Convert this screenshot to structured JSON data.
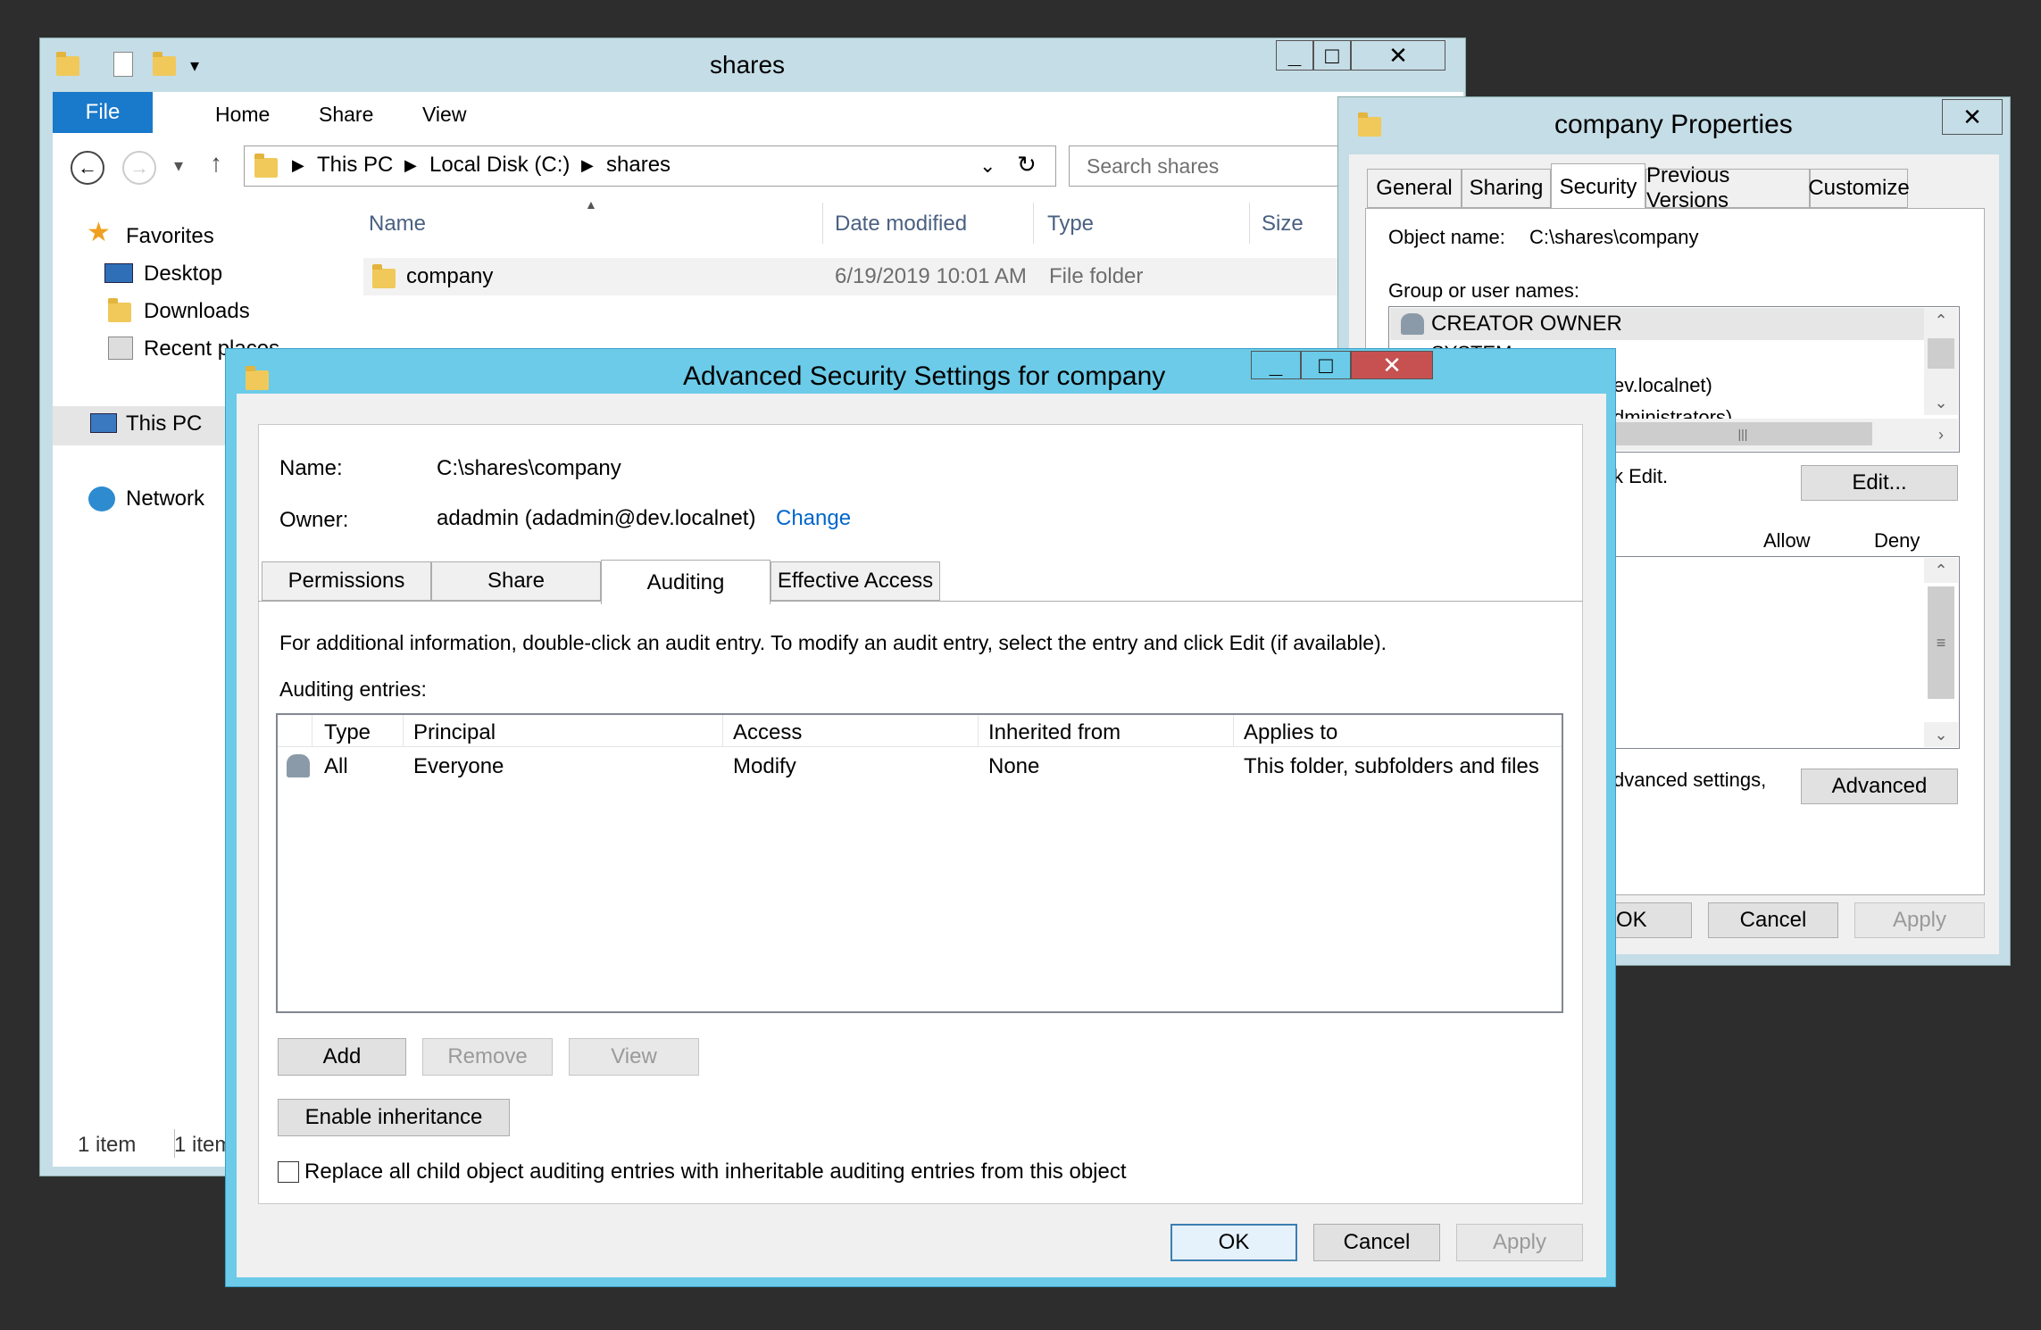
{
  "explorer": {
    "title": "shares",
    "ribbon_tabs": [
      "File",
      "Home",
      "Share",
      "View"
    ],
    "breadcrumb": [
      "This PC",
      "Local Disk (C:)",
      "shares"
    ],
    "search_placeholder": "Search shares",
    "nav": {
      "favorites": "Favorites",
      "desktop": "Desktop",
      "downloads": "Downloads",
      "recent": "Recent places",
      "this_pc": "This PC",
      "network": "Network"
    },
    "columns": {
      "name": "Name",
      "date": "Date modified",
      "type": "Type",
      "size": "Size"
    },
    "row": {
      "name": "company",
      "date": "6/19/2019 10:01 AM",
      "type": "File folder"
    },
    "status_left": "1 item",
    "status_right": "1 item"
  },
  "props": {
    "title": "company Properties",
    "tabs": [
      "General",
      "Sharing",
      "Security",
      "Previous Versions",
      "Customize"
    ],
    "object_label": "Object name:",
    "object_value": "C:\\shares\\company",
    "group_label": "Group or user names:",
    "users": [
      "CREATOR OWNER",
      "SYSTEM",
      "ev.localnet)",
      "dministrators)"
    ],
    "edit_hint": "k Edit.",
    "edit_button": "Edit...",
    "allow": "Allow",
    "deny": "Deny",
    "adv_hint": "dvanced settings,",
    "advanced_button": "Advanced",
    "ok": "OK",
    "cancel": "Cancel",
    "apply": "Apply"
  },
  "adv": {
    "title": "Advanced Security Settings for company",
    "name_label": "Name:",
    "name_value": "C:\\shares\\company",
    "owner_label": "Owner:",
    "owner_value": "adadmin (adadmin@dev.localnet)",
    "change_link": "Change",
    "tabs": [
      "Permissions",
      "Share",
      "Auditing",
      "Effective Access"
    ],
    "info": "For additional information, double-click an audit entry. To modify an audit entry, select the entry and click Edit (if available).",
    "entries_label": "Auditing entries:",
    "columns": [
      "Type",
      "Principal",
      "Access",
      "Inherited from",
      "Applies to"
    ],
    "entry": [
      "All",
      "Everyone",
      "Modify",
      "None",
      "This folder, subfolders and files"
    ],
    "add": "Add",
    "remove": "Remove",
    "view": "View",
    "enable_inheritance": "Enable inheritance",
    "replace_label": "Replace all child object auditing entries with inheritable auditing entries from this object",
    "ok": "OK",
    "cancel": "Cancel",
    "apply": "Apply"
  },
  "colors": {
    "accent": "#1979ca",
    "adv_frame": "#6bcbe8",
    "close_red": "#c75050",
    "link": "#0066cc"
  }
}
